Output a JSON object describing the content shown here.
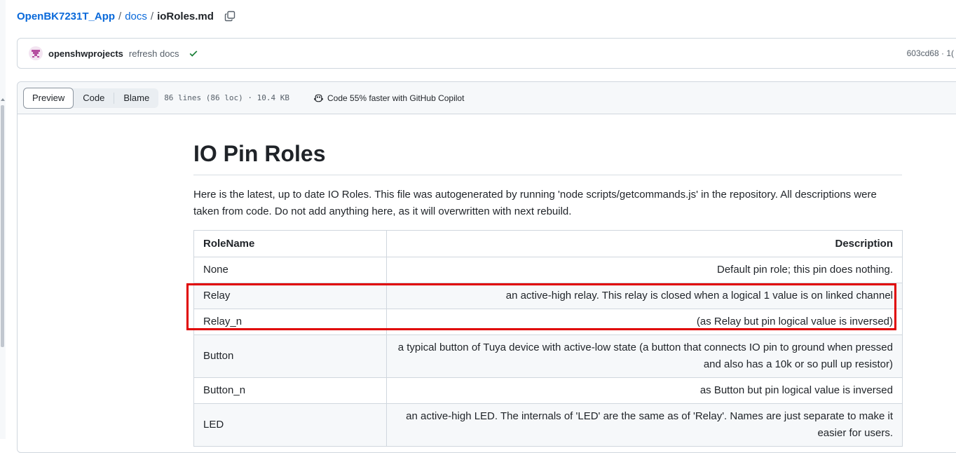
{
  "breadcrumb": {
    "repo": "OpenBK7231T_App",
    "sep1": "/",
    "dir": "docs",
    "sep2": "/",
    "file": "ioRoles.md"
  },
  "commit": {
    "author": "openshwprojects",
    "message": "refresh docs",
    "sha": "603cd68 · 1("
  },
  "file_header": {
    "tabs": [
      "Preview",
      "Code",
      "Blame"
    ],
    "active_tab": "Preview",
    "meta": "86 lines (86 loc) · 10.4 KB",
    "copilot": "Code 55% faster with GitHub Copilot"
  },
  "markdown": {
    "title": "IO Pin Roles",
    "intro": "Here is the latest, up to date IO Roles. This file was autogenerated by running 'node scripts/getcommands.js' in the repository. All descriptions were taken from code. Do not add anything here, as it will overwritten with next rebuild.",
    "table": {
      "headers": [
        "RoleName",
        "Description"
      ],
      "rows": [
        [
          "None",
          "Default pin role; this pin does nothing."
        ],
        [
          "Relay",
          "an active-high relay. This relay is closed when a logical 1 value is on linked channel"
        ],
        [
          "Relay_n",
          "(as Relay but pin logical value is inversed)"
        ],
        [
          "Button",
          "a typical button of Tuya device with active-low state (a button that connects IO pin to ground when pressed and also has a 10k or so pull up resistor)"
        ],
        [
          "Button_n",
          "as Button but pin logical value is inversed"
        ],
        [
          "LED",
          "an active-high LED. The internals of 'LED' are the same as of 'Relay'. Names are just separate to make it easier for users."
        ]
      ]
    }
  },
  "colors": {
    "link": "#0969da",
    "success": "#1a7f37",
    "highlight": "#e00000"
  }
}
